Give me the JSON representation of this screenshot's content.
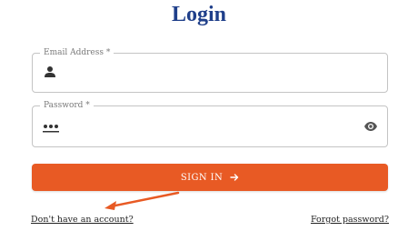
{
  "title": "Login",
  "email_field": {
    "label": "Email Address *",
    "value": "",
    "icon": "person-icon"
  },
  "password_field": {
    "label": "Password *",
    "masked_value": "•••",
    "toggle_icon": "eye-icon"
  },
  "signin_button": {
    "label": "SIGN IN",
    "icon": "arrow-right-icon"
  },
  "links": {
    "signup": "Don't have an account?",
    "forgot": "Forgot password?"
  },
  "colors": {
    "title": "#1f3f8a",
    "button": "#e85a24",
    "annotation_arrow": "#e85a24"
  }
}
